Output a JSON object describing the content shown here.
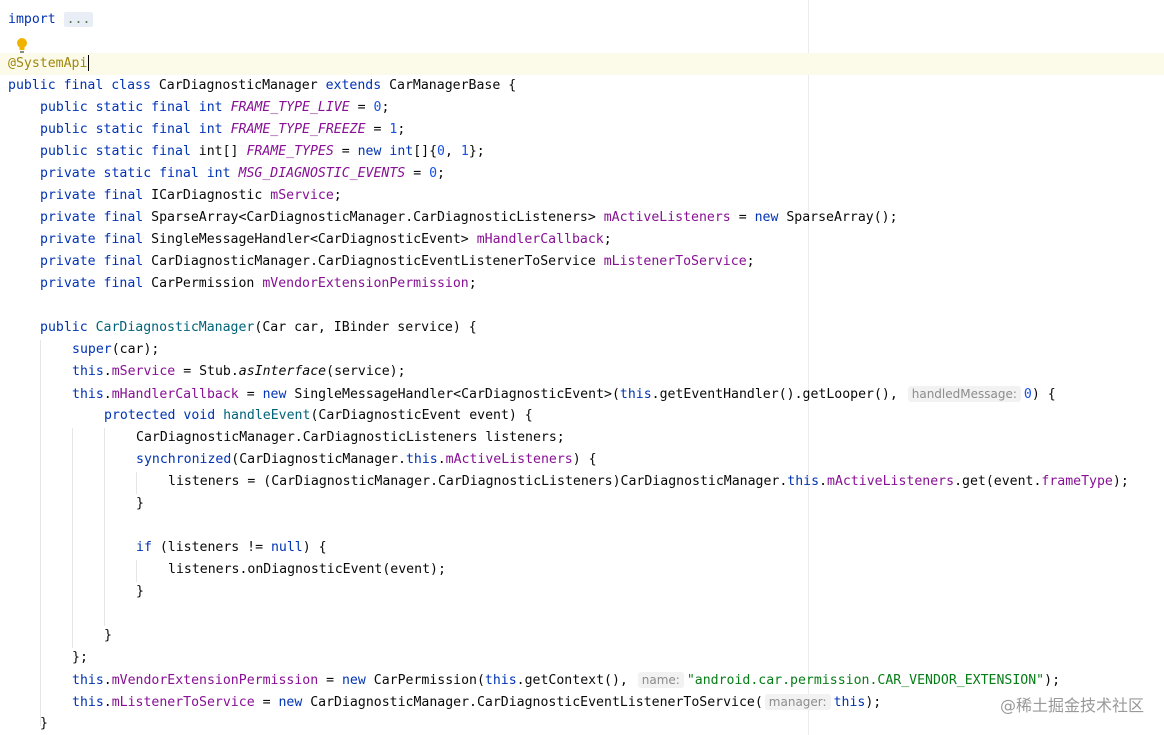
{
  "code": {
    "import_kw": "import",
    "import_fold": "...",
    "annotation": "@SystemApi",
    "class_decl": {
      "kw1": "public final class",
      "name": " CarDiagnosticManager ",
      "kw2": "extends",
      "rest": " CarManagerBase {"
    },
    "f1": {
      "mods": "public static final int",
      "name": "FRAME_TYPE_LIVE",
      "eq": " = ",
      "val": "0",
      "end": ";"
    },
    "f2": {
      "mods": "public static final int",
      "name": "FRAME_TYPE_FREEZE",
      "eq": " = ",
      "val": "1",
      "end": ";"
    },
    "f3": {
      "mods": "public static final",
      "type": " int[] ",
      "name": "FRAME_TYPES",
      "eq": " = ",
      "kw_new": "new",
      "kw_int": "int",
      "arr": "[]{",
      "v0": "0",
      "comma": ", ",
      "v1": "1",
      "end": "};"
    },
    "f4": {
      "mods": "private static final int",
      "name": "MSG_DIAGNOSTIC_EVENTS",
      "eq": " = ",
      "val": "0",
      "end": ";"
    },
    "f5": {
      "mods": "private final",
      "type": " ICarDiagnostic ",
      "name": "mService",
      "end": ";"
    },
    "f6": {
      "mods": "private final",
      "type": " SparseArray<CarDiagnosticManager.CarDiagnosticListeners> ",
      "name": "mActiveListeners",
      "eq": " = ",
      "kw_new": "new",
      "rest": " SparseArray();"
    },
    "f7": {
      "mods": "private final",
      "type": " SingleMessageHandler<CarDiagnosticEvent> ",
      "name": "mHandlerCallback",
      "end": ";"
    },
    "f8": {
      "mods": "private final",
      "type": " CarDiagnosticManager.CarDiagnosticEventListenerToService ",
      "name": "mListenerToService",
      "end": ";"
    },
    "f9": {
      "mods": "private final",
      "type": " CarPermission ",
      "name": "mVendorExtensionPermission",
      "end": ";"
    },
    "ctor": {
      "kw": "public",
      "name": " CarDiagnosticManager",
      "params": "(Car car, IBinder service) {"
    },
    "c1": {
      "kw": "super",
      "rest": "(car);"
    },
    "c2": {
      "kw": "this",
      "dot": ".",
      "fld": "mService",
      "eq": " = Stub.",
      "call": "asInterface",
      "rest": "(service);"
    },
    "c3": {
      "kw": "this",
      "dot": ".",
      "fld": "mHandlerCallback",
      "eq": " = ",
      "kw_new": "new",
      "mid": " SingleMessageHandler<CarDiagnosticEvent>(",
      "kw_this": "this",
      "rest": ".getEventHandler().getLooper(), ",
      "hint": "handledMessage:",
      "val": "0",
      "end": ") {"
    },
    "c4": {
      "kw": "protected void",
      "name": " handleEvent",
      "rest": "(CarDiagnosticEvent event) {"
    },
    "c5": "CarDiagnosticManager.CarDiagnosticListeners listeners;",
    "c6": {
      "kw": "synchronized",
      "a": "(CarDiagnosticManager.",
      "kw_this": "this",
      "dot": ".",
      "fld": "mActiveListeners",
      "end": ") {"
    },
    "c7": {
      "a": "listeners = (CarDiagnosticManager.CarDiagnosticListeners)CarDiagnosticManager.",
      "kw_this": "this",
      "dot": ".",
      "fld": "mActiveListeners",
      "b": ".get(event.",
      "fld2": "frameType",
      "end": ");"
    },
    "close": "}",
    "c8": {
      "kw": "if",
      "a": " (listeners != ",
      "kw_null": "null",
      "end": ") {"
    },
    "c9": "listeners.onDiagnosticEvent(event);",
    "close_semicolon": "};",
    "c10": {
      "kw": "this",
      "dot": ".",
      "fld": "mVendorExtensionPermission",
      "eq": " = ",
      "kw_new": "new",
      "mid": " CarPermission(",
      "kw_this": "this",
      "rest": ".getContext(), ",
      "hint": "name:",
      "str": "\"android.car.permission.CAR_VENDOR_EXTENSION\"",
      "end": ");"
    },
    "c11": {
      "kw": "this",
      "dot": ".",
      "fld": "mListenerToService",
      "eq": " = ",
      "kw_new": "new",
      "mid": " CarDiagnosticManager.CarDiagnosticEventListenerToService(",
      "hint": "manager:",
      "kw_this": "this",
      "end": ");"
    }
  },
  "watermark": "@稀土掘金技术社区",
  "colors": {
    "keyword": "#0033b3",
    "field": "#871094",
    "number": "#1750eb",
    "string": "#067d17",
    "method": "#00627a",
    "highlight_row": "#fcfae9"
  },
  "icons": {
    "intention": "lightbulb-icon"
  }
}
